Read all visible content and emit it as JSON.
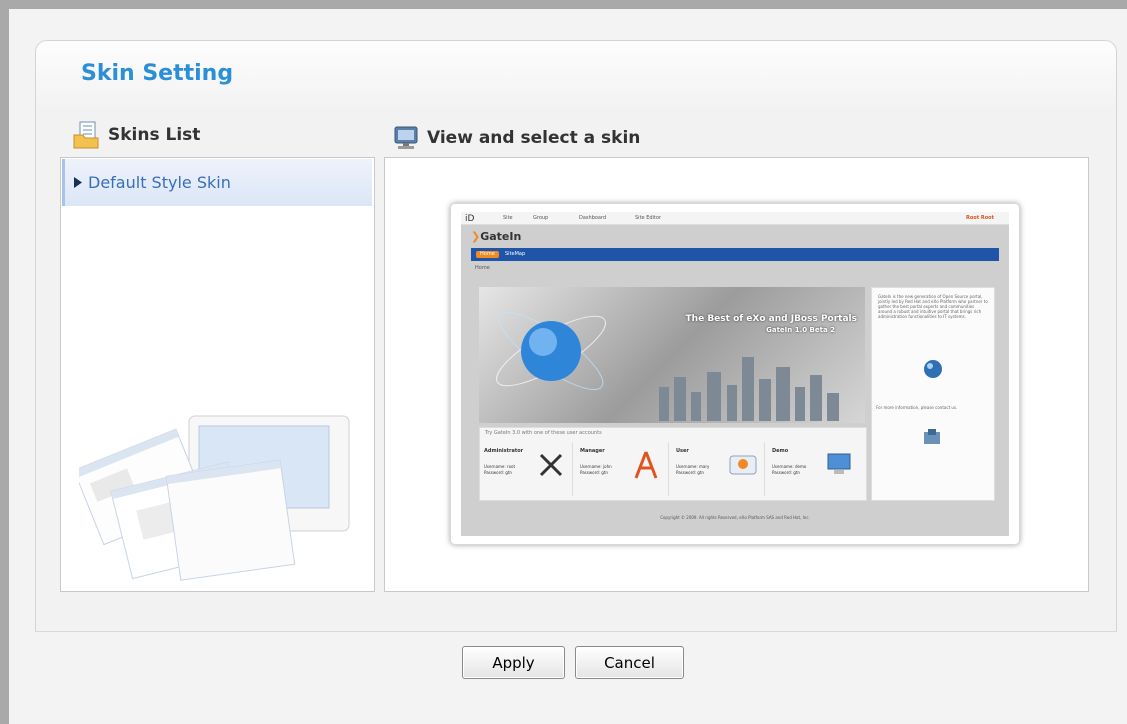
{
  "title": "Skin Setting",
  "skins_list": {
    "heading": "Skins List",
    "items": [
      {
        "label": "Default Style Skin",
        "selected": true
      }
    ]
  },
  "viewer": {
    "heading": "View and select a skin",
    "preview": {
      "toolbar_items": [
        "Site",
        "Group",
        "Dashboard",
        "Site Editor"
      ],
      "toolbar_user": "Root Root",
      "logo": "GateIn",
      "nav_tabs": [
        "Home",
        "SiteMap"
      ],
      "breadcrumb": "Home",
      "banner_title": "The Best of eXo and JBoss Portals",
      "banner_subtitle": "GateIn 1.0 Beta 2",
      "accounts_intro": "Try GateIn 3.0 with one of these user accounts",
      "accounts": [
        {
          "role": "Administrator",
          "username": "Username: root",
          "password": "Password: gtn"
        },
        {
          "role": "Manager",
          "username": "Username: john",
          "password": "Password: gtn"
        },
        {
          "role": "User",
          "username": "Username: mary",
          "password": "Password: gtn"
        },
        {
          "role": "Demo",
          "username": "Username: demo",
          "password": "Password: gtn"
        }
      ],
      "side_text": "GateIn is the new generation of Open Source portal, jointly led by Red Hat and eXo Platform who partner to gather the best portal experts and communities around a robust and intuitive portal that brings rich administration functionalities to IT systems.",
      "side_contact": "For more information, please contact us.",
      "copyright": "Copyright © 2009. All rights Reserved, eXo Platform SAS and Red Hat, Inc."
    }
  },
  "buttons": {
    "apply": "Apply",
    "cancel": "Cancel"
  },
  "colors": {
    "title": "#2b8fd8",
    "selected_item_text": "#3a6fb8",
    "preview_nav": "#1f55a8"
  }
}
